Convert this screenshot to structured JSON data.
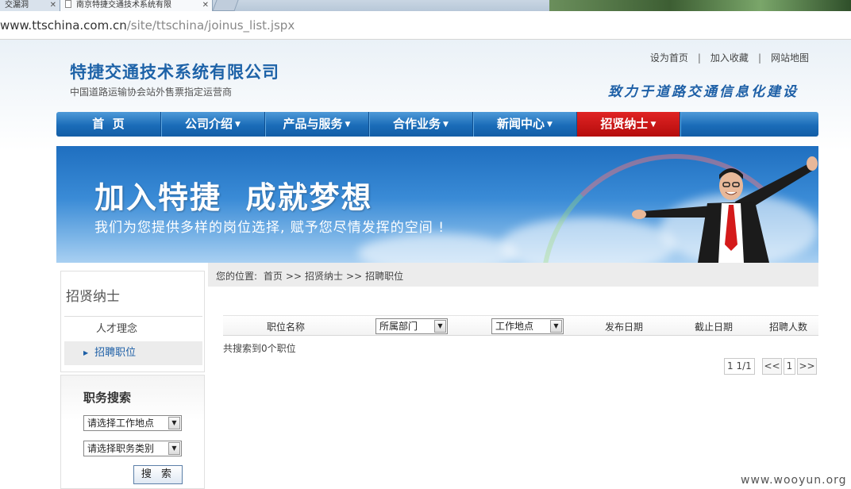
{
  "browser": {
    "tabs": [
      {
        "label": "交漏洞",
        "active": false
      },
      {
        "label": "南京特捷交通技术系统有限",
        "active": true
      }
    ],
    "url_host": "www.ttschina.com.cn",
    "url_path": "/site/ttschina/joinus_list.jspx"
  },
  "header": {
    "company_name": "特捷交通技术系统有限公司",
    "company_sub": "中国道路运输协会站外售票指定运营商",
    "toplinks": [
      "设为首页",
      "加入收藏",
      "网站地图"
    ],
    "separator": "|",
    "slogan": "致力于道路交通信息化建设"
  },
  "nav": {
    "items": [
      {
        "label": "首  页",
        "has_menu": false,
        "active": false
      },
      {
        "label": "公司介绍",
        "has_menu": true,
        "active": false
      },
      {
        "label": "产品与服务",
        "has_menu": true,
        "active": false
      },
      {
        "label": "合作业务",
        "has_menu": true,
        "active": false
      },
      {
        "label": "新闻中心",
        "has_menu": true,
        "active": false
      },
      {
        "label": "招贤纳士",
        "has_menu": true,
        "active": true
      }
    ]
  },
  "banner": {
    "title": "加入特捷  成就梦想",
    "subtitle": "我们为您提供多样的岗位选择, 赋予您尽情发挥的空间 !"
  },
  "sidebar": {
    "title": "招贤纳士",
    "links": [
      {
        "label": "人才理念",
        "active": false
      },
      {
        "label": "招聘职位",
        "active": true
      }
    ]
  },
  "job_search": {
    "title": "职务搜索",
    "location_select": "请选择工作地点",
    "category_select": "请选择职务类别",
    "search_button": "搜 索"
  },
  "breadcrumb": {
    "prefix": "您的位置:",
    "items": [
      "首页",
      "招贤纳士",
      "招聘职位"
    ],
    "separator": ">>"
  },
  "table": {
    "col_position": "职位名称",
    "col_department": "所属部门",
    "col_location": "工作地点",
    "col_publish_date": "发布日期",
    "col_deadline": "截止日期",
    "col_headcount": "招聘人数"
  },
  "results": {
    "summary": "共搜索到0个职位"
  },
  "pager": {
    "info": "1 1/1",
    "prev": "<<",
    "current": "1",
    "next": ">>"
  },
  "watermark": "www.wooyun.org",
  "colors": {
    "brand_blue": "#1e63a8",
    "nav_blue": "#1a6cb8",
    "nav_active_red": "#c41414"
  }
}
